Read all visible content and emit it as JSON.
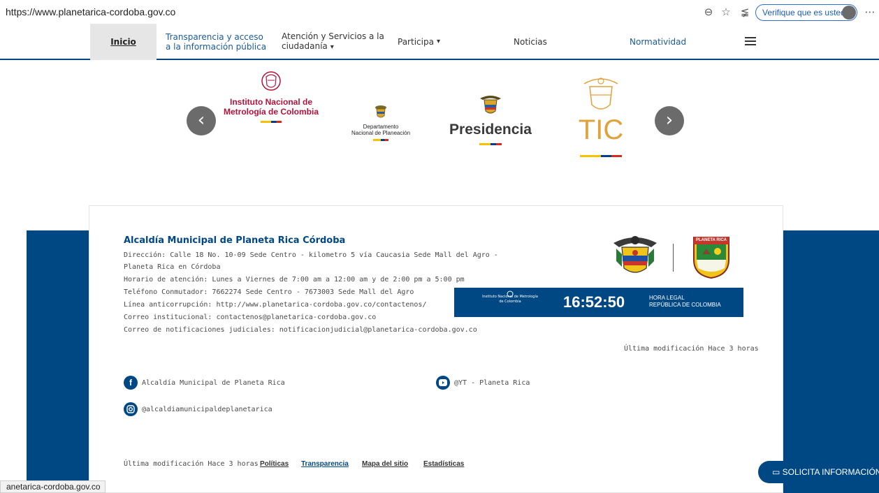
{
  "browser": {
    "url": "https://www.planetarica-cordoba.gov.co",
    "verify_label": "Verifique que es usted",
    "status_text": "anetarica-cordoba.gov.co"
  },
  "nav": {
    "home": "Inicio",
    "transparency_1": "Transparencia y acceso",
    "transparency_2": "a la información pública",
    "attention_1": "Atención y Servicios a la",
    "attention_2": "ciudadanía",
    "participa": "Participa",
    "news": "Noticias",
    "regulation": "Normatividad"
  },
  "carousel": {
    "inm_1": "Instituto Nacional de",
    "inm_2": "Metrología de Colombia",
    "dnp_1": "Departamento",
    "dnp_2": "Nacional de Planeación",
    "presidencia": "Presidencia",
    "tic": "TIC"
  },
  "footer": {
    "org_name": "Alcaldía Municipal de Planeta Rica Córdoba",
    "address_1": "Dirección: Calle 18 No. 10-09 Sede Centro - kilometro 5 vía Caucasia Sede Mall del Agro -",
    "address_2": "Planeta Rica en Córdoba",
    "hours": "Horario de atención: Lunes a Viernes de 7:00 am a 12:00 am y de 2:00 pm a 5:00 pm",
    "phone": "Teléfono Conmutador: 7662274 Sede Centro - 7673003 Sede Mall del Agro",
    "anticorruption": "Línea anticorrupción: http://www.planetarica-cordoba.gov.co/contactenos/",
    "email": "Correo institucional: contactenos@planetarica-cordoba.gov.co",
    "judicial_email": "Correo de notificaciones judiciales: notificacionjudicial@planetarica-cordoba.gov.co",
    "last_modified": "Última modificación Hace 3 horas",
    "crest_label": "PLANETA RICA",
    "clock": {
      "inm_small": "Instituto Nacional de Metrología de Colombia",
      "time": "16:52:50",
      "label_1": "HORA LEGAL",
      "label_2": "REPÚBLICA DE COLOMBIA"
    },
    "social": {
      "facebook": "Alcaldía Municipal de Planeta Rica",
      "youtube": "@YT - Planeta Rica",
      "instagram": "@alcaldiamunicipaldeplanetarica"
    },
    "bottom_modified": "Última modificación Hace 3 horas",
    "links": {
      "policies": "Políticas",
      "transparency": "Transparencia",
      "sitemap": "Mapa del sitio",
      "stats": "Estadísticas"
    },
    "solicita": "SOLICITA INFORMACIÓN"
  },
  "colors": {
    "brand_blue": "#004884",
    "inm_red": "#b5123b",
    "tic_gold": "#e0a23a"
  }
}
